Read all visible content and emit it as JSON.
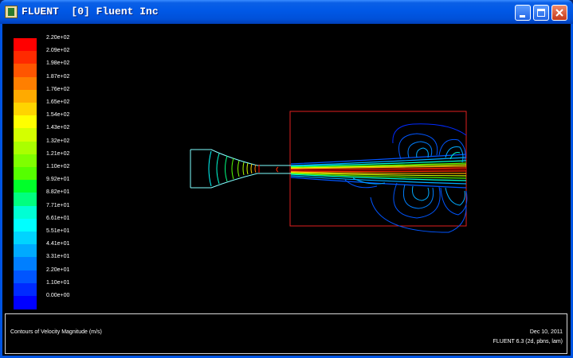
{
  "window": {
    "title": "FLUENT  [0] Fluent Inc"
  },
  "titlebar_buttons": [
    "minimize",
    "maximize",
    "close"
  ],
  "colorbar": {
    "labels": [
      "2.20e+02",
      "2.09e+02",
      "1.98e+02",
      "1.87e+02",
      "1.76e+02",
      "1.65e+02",
      "1.54e+02",
      "1.43e+02",
      "1.32e+02",
      "1.21e+02",
      "1.10e+02",
      "9.92e+01",
      "8.82e+01",
      "7.71e+01",
      "6.61e+01",
      "5.51e+01",
      "4.41e+01",
      "3.31e+01",
      "2.20e+01",
      "1.10e+01",
      "0.00e+00"
    ],
    "colors": [
      "#ff0000",
      "#ff2a00",
      "#ff5500",
      "#ff7f00",
      "#ffaa00",
      "#ffd400",
      "#ffff00",
      "#d4ff00",
      "#aaff00",
      "#7fff00",
      "#55ff00",
      "#00ff2a",
      "#00ff7f",
      "#00ffd4",
      "#00ffff",
      "#00d4ff",
      "#00aaff",
      "#007fff",
      "#0055ff",
      "#002aff",
      "#0000ff"
    ]
  },
  "info": {
    "caption": "Contours of Velocity Magnitude (m/s)",
    "date": "Dec 10, 2011",
    "version": "FLUENT 6.3 (2d, pbns, lam)"
  }
}
